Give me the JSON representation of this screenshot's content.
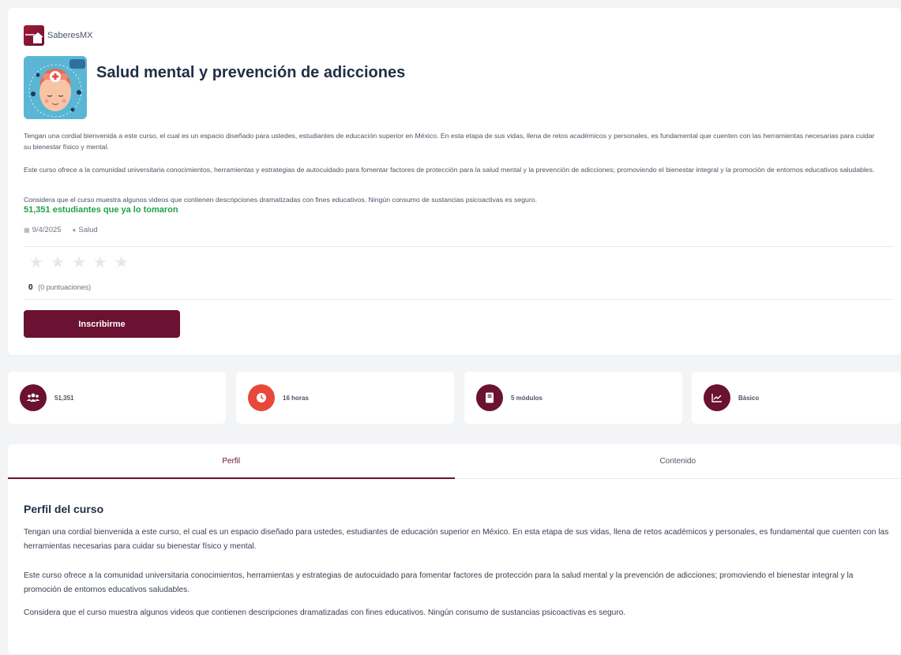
{
  "brand": {
    "name": "SaberesMX"
  },
  "course": {
    "title": "Salud mental y prevención de adicciones",
    "description": [
      "Tengan una cordial bienvenida a este curso, el cual es un espacio diseñado para ustedes, estudiantes de educación superior en México. En esta etapa de sus vidas, llena de retos académicos y personales, es fundamental que cuenten con las herramientas necesarias para cuidar su bienestar físico y mental.",
      "Este curso ofrece a la comunidad universitaria conocimientos, herramientas y estrategias de autocuidado para fomentar factores de protección para la salud mental y la prevención de adicciones; promoviendo el bienestar integral y la promoción de entornos educativos saludables.",
      "Considera que el curso muestra algunos videos que contienen descripciones dramatizadas con fines educativos. Ningún consumo de sustancias psicoactivas es seguro."
    ],
    "students_text": "51,351 estudiantes que ya lo tomaron",
    "date": "9/4/2025",
    "category": "Salud",
    "rating": {
      "value": "0",
      "count_text": "(0 puntuaciones)",
      "stars_filled": 0,
      "stars_total": 5
    },
    "enroll_label": "Inscribirme"
  },
  "stats": [
    {
      "icon": "users-icon",
      "label": "51,351",
      "color": "#6b1131"
    },
    {
      "icon": "clock-icon",
      "label": "16 horas",
      "color": "#e8483b"
    },
    {
      "icon": "book-icon",
      "label": "5 módulos",
      "color": "#6b1131"
    },
    {
      "icon": "chart-line-icon",
      "label": "Básico",
      "color": "#6b1131"
    }
  ],
  "tabs": [
    {
      "label": "Perfil",
      "active": true
    },
    {
      "label": "Contenido",
      "active": false
    }
  ],
  "profile": {
    "title": "Perfil del curso",
    "paragraphs": [
      "Tengan una cordial bienvenida a este curso, el cual es un espacio diseñado para ustedes, estudiantes de educación superior en México. En esta etapa de sus vidas, llena de retos académicos y personales, es fundamental que cuenten con las herramientas necesarias para cuidar su bienestar físico y mental.",
      "Este curso ofrece a la comunidad universitaria conocimientos, herramientas y estrategias de autocuidado para fomentar factores de protección para la salud mental y la prevención de adicciones; promoviendo el bienestar integral y la promoción de entornos educativos saludables.",
      "Considera que el curso muestra algunos videos que contienen descripciones dramatizadas con fines educativos. Ningún consumo de sustancias psicoactivas es seguro."
    ]
  },
  "colors": {
    "brand": "#6b1131",
    "success": "#22a04b",
    "accent": "#e8483b"
  }
}
